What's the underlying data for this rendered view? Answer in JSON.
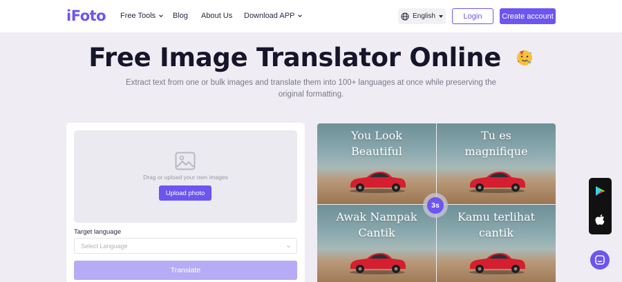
{
  "header": {
    "logo": "iFoto",
    "nav": [
      {
        "label": "Free Tools",
        "has_dropdown": true
      },
      {
        "label": "Blog",
        "has_dropdown": false
      },
      {
        "label": "About Us",
        "has_dropdown": false
      },
      {
        "label": "Download APP",
        "has_dropdown": true
      }
    ],
    "language": "English",
    "login_label": "Login",
    "create_account_label": "Create account"
  },
  "hero": {
    "title": "Free Image Translator Online",
    "subtitle": "Extract text from one or bulk images and translate them into 100+ languages at once while preserving the original formatting.",
    "emoji": "party-face-emoji"
  },
  "upload_card": {
    "drop_text": "Drag or upload your own images",
    "upload_label": "Upload photo",
    "target_label": "Target language",
    "select_placeholder": "Select Language",
    "translate_label": "Translate"
  },
  "demo": {
    "captions": [
      "You Look Beautiful",
      "Tu es magnifique",
      "Awak Nampak Cantik",
      "Kamu terlihat cantik"
    ],
    "caption_lines": [
      [
        "You Look",
        "Beautiful"
      ],
      [
        "Tu es",
        "magnifique"
      ],
      [
        "Awak Nampak",
        "Cantik"
      ],
      [
        "Kamu terlihat",
        "cantik"
      ]
    ],
    "timer": "3s"
  },
  "side_apps": [
    "google-play-icon",
    "apple-icon"
  ],
  "colors": {
    "accent": "#6c55f0",
    "accent_disabled": "#b6abf5",
    "page_bg": "#efedf3"
  }
}
